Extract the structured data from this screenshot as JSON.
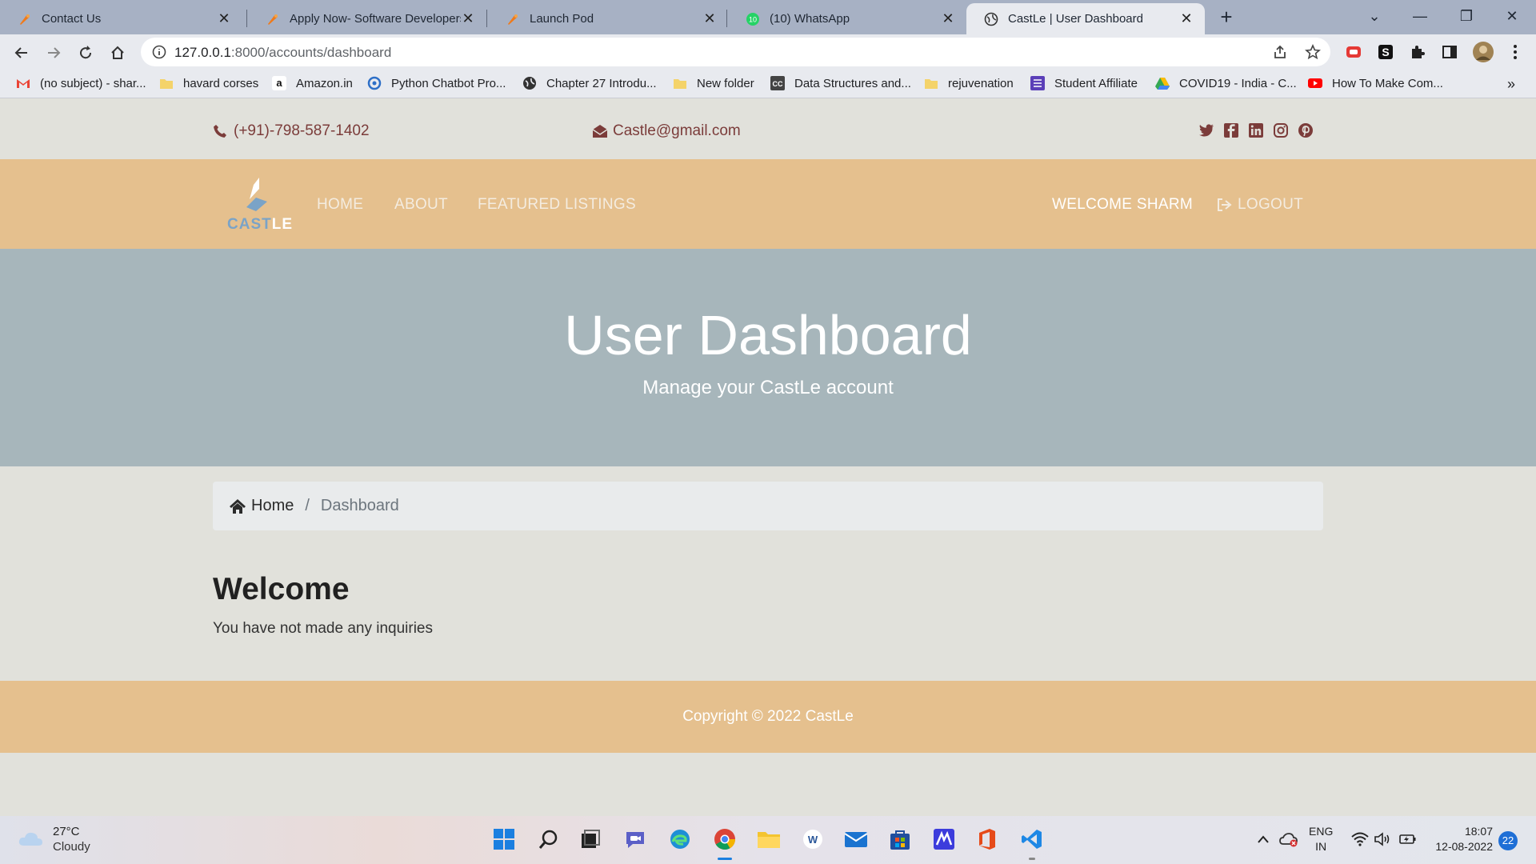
{
  "browser": {
    "tabs": [
      {
        "title": "Contact Us"
      },
      {
        "title": "Apply Now- Software Developers"
      },
      {
        "title": "Launch Pod"
      },
      {
        "title": "(10) WhatsApp"
      },
      {
        "title": "CastLe | User Dashboard"
      }
    ],
    "url_host": "127.0.0.1",
    "url_rest": ":8000/accounts/dashboard",
    "bookmarks": [
      "(no subject) - shar...",
      "havard corses",
      "Amazon.in",
      "Python Chatbot Pro...",
      "Chapter 27 Introdu...",
      "New folder",
      "Data Structures and...",
      "rejuvenation",
      "Student Affiliate",
      "COVID19 - India - C...",
      "How To Make Com..."
    ],
    "bookmarks_more": "»"
  },
  "site": {
    "phone": "(+91)-798-587-1402",
    "email": "Castle@gmail.com",
    "logo_text": "CASTLE",
    "nav": {
      "home": "HOME",
      "about": "ABOUT",
      "featured": "FEATURED LISTINGS",
      "welcome": "WELCOME SHARM",
      "logout": "LOGOUT"
    },
    "hero": {
      "title": "User Dashboard",
      "subtitle": "Manage your CastLe account"
    },
    "breadcrumb": {
      "home": "Home",
      "separator": "/",
      "current": "Dashboard"
    },
    "welcome_heading": "Welcome",
    "inquiries_text": "You have not made any inquiries",
    "footer": "Copyright © 2022 CastLe",
    "colors": {
      "accent": "#7b3c3a",
      "navbar": "#e5c08e",
      "hero": "#a7b6bb"
    }
  },
  "taskbar": {
    "temp": "27°C",
    "condition": "Cloudy",
    "lang1": "ENG",
    "lang2": "IN",
    "time": "18:07",
    "date": "12-08-2022",
    "notifications": "22"
  }
}
